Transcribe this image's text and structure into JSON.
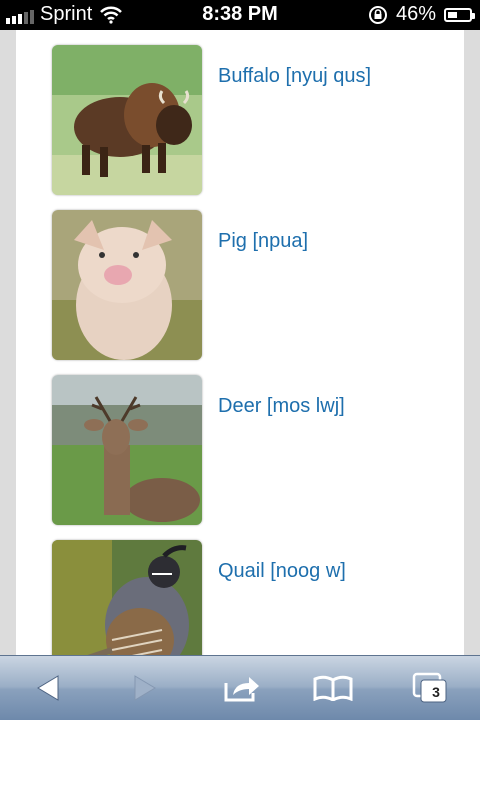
{
  "status_bar": {
    "carrier": "Sprint",
    "time": "8:38 PM",
    "battery": "46%",
    "battery_level": 0.46
  },
  "animals": [
    {
      "label": "Buffalo [nyuj qus]",
      "image": "buffalo-photo"
    },
    {
      "label": "Pig [npua]",
      "image": "pig-photo"
    },
    {
      "label": "Deer [mos lwj]",
      "image": "deer-photo"
    },
    {
      "label": "Quail [noog w]",
      "image": "quail-photo"
    }
  ],
  "toolbar": {
    "back_icon": "back-arrow-icon",
    "forward_icon": "forward-arrow-icon",
    "share_icon": "share-icon",
    "bookmarks_icon": "bookmarks-book-icon",
    "tabs_icon": "tabs-icon",
    "tab_count": "3"
  },
  "colors": {
    "link": "#1e6fad",
    "page_background": "#dcdcdc",
    "toolbar": "#8aa1bd"
  }
}
